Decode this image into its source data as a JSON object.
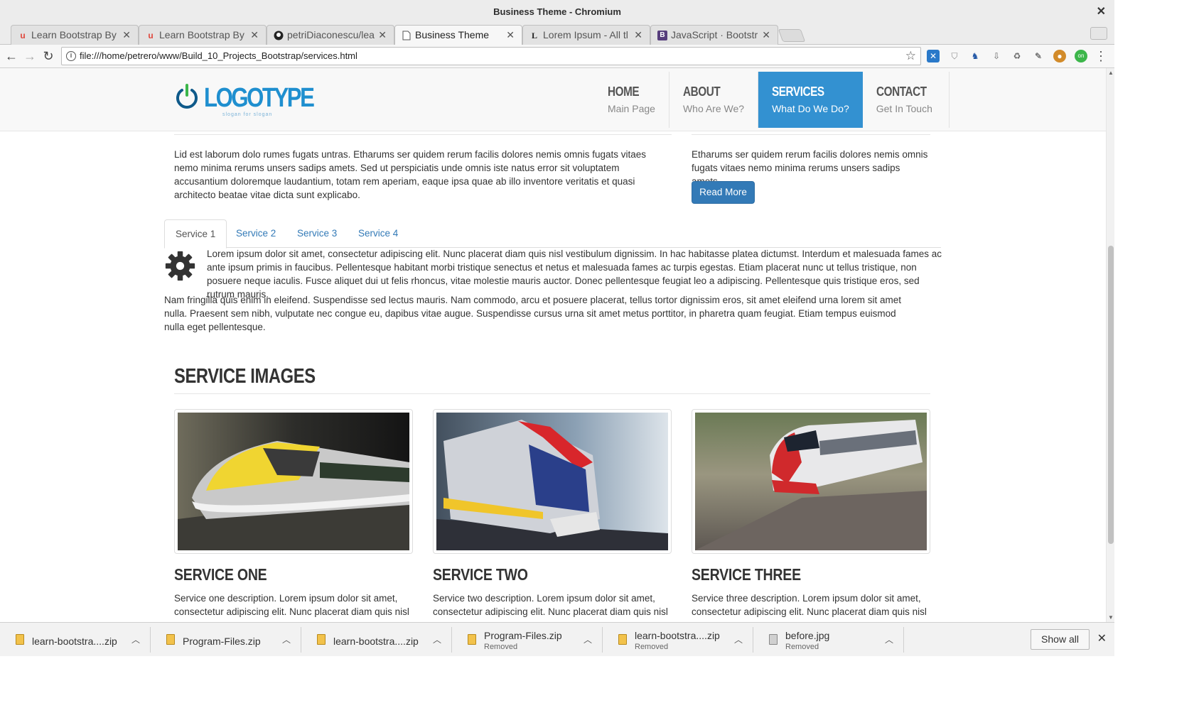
{
  "window": {
    "title": "Business Theme - Chromium"
  },
  "tabs": [
    {
      "label": "Learn Bootstrap By",
      "favicon": "u"
    },
    {
      "label": "Learn Bootstrap By",
      "favicon": "u"
    },
    {
      "label": "petriDiaconescu/lea",
      "favicon": "gh"
    },
    {
      "label": "Business Theme",
      "favicon": "page"
    },
    {
      "label": "Lorem Ipsum - All tl",
      "favicon": "L"
    },
    {
      "label": "JavaScript · Bootstr",
      "favicon": "B"
    }
  ],
  "toolbar": {
    "url": "file:///home/petrero/www/Build_10_Projects_Bootstrap/services.html"
  },
  "site": {
    "logo_text": "LOGOTYPE",
    "logo_tagline": "slogan for slogan",
    "nav": [
      {
        "title": "HOME",
        "sub": "Main Page"
      },
      {
        "title": "ABOUT",
        "sub": "Who Are We?"
      },
      {
        "title": "SERVICES",
        "sub": "What Do We Do?"
      },
      {
        "title": "CONTACT",
        "sub": "Get In Touch"
      }
    ]
  },
  "content": {
    "left_para": "Lid est laborum dolo rumes fugats untras. Etharums ser quidem rerum facilis dolores nemis omnis fugats vitaes nemo minima rerums unsers sadips amets. Sed ut perspiciatis unde omnis iste natus error sit voluptatem accusantium doloremque laudantium, totam rem aperiam, eaque ipsa quae ab illo inventore veritatis et quasi architecto beatae vitae dicta sunt explicabo.",
    "right_para": "Etharums ser quidem rerum facilis dolores nemis omnis fugats vitaes nemo minima rerums unsers sadips amets.",
    "read_more": "Read More",
    "service_tabs": [
      "Service 1",
      "Service 2",
      "Service 3",
      "Service 4"
    ],
    "tab_para_1": "Lorem ipsum dolor sit amet, consectetur adipiscing elit. Nunc placerat diam quis nisl vestibulum dignissim. In hac habitasse platea dictumst. Interdum et malesuada fames ac ante ipsum primis in faucibus. Pellentesque habitant morbi tristique senectus et netus et malesuada fames ac turpis egestas. Etiam placerat nunc ut tellus tristique, non posuere neque iaculis. Fusce aliquet dui ut felis rhoncus, vitae molestie mauris auctor. Donec pellentesque feugiat leo a adipiscing. Pellentesque quis tristique eros, sed rutrum mauris.",
    "tab_para_2": "Nam fringilla quis enim in eleifend. Suspendisse sed lectus mauris. Nam commodo, arcu et posuere placerat, tellus tortor dignissim eros, sit amet eleifend urna lorem sit amet nulla. Praesent sem nibh, vulputate nec congue eu, dapibus vitae augue. Suspendisse cursus urna sit amet metus porttitor, in pharetra quam feugiat. Etiam tempus euismod nulla eget pellentesque.",
    "section_title": "SERVICE IMAGES",
    "services": [
      {
        "title": "SERVICE ONE",
        "desc": "Service one description. Lorem ipsum dolor sit amet, consectetur adipiscing elit. Nunc placerat diam quis nisl"
      },
      {
        "title": "SERVICE TWO",
        "desc": "Service two description. Lorem ipsum dolor sit amet, consectetur adipiscing elit. Nunc placerat diam quis nisl"
      },
      {
        "title": "SERVICE THREE",
        "desc": "Service three description. Lorem ipsum dolor sit amet, consectetur adipiscing elit. Nunc placerat diam quis nisl"
      }
    ]
  },
  "downloads": {
    "items": [
      {
        "name": "learn-bootstra....zip",
        "status": ""
      },
      {
        "name": "Program-Files.zip",
        "status": ""
      },
      {
        "name": "learn-bootstra....zip",
        "status": ""
      },
      {
        "name": "Program-Files.zip",
        "status": "Removed"
      },
      {
        "name": "learn-bootstra....zip",
        "status": "Removed"
      },
      {
        "name": "before.jpg",
        "status": "Removed"
      }
    ],
    "show_all": "Show all"
  },
  "colors": {
    "accent": "#3391d1",
    "primary_button": "#337ab7",
    "link": "#337ab7"
  }
}
